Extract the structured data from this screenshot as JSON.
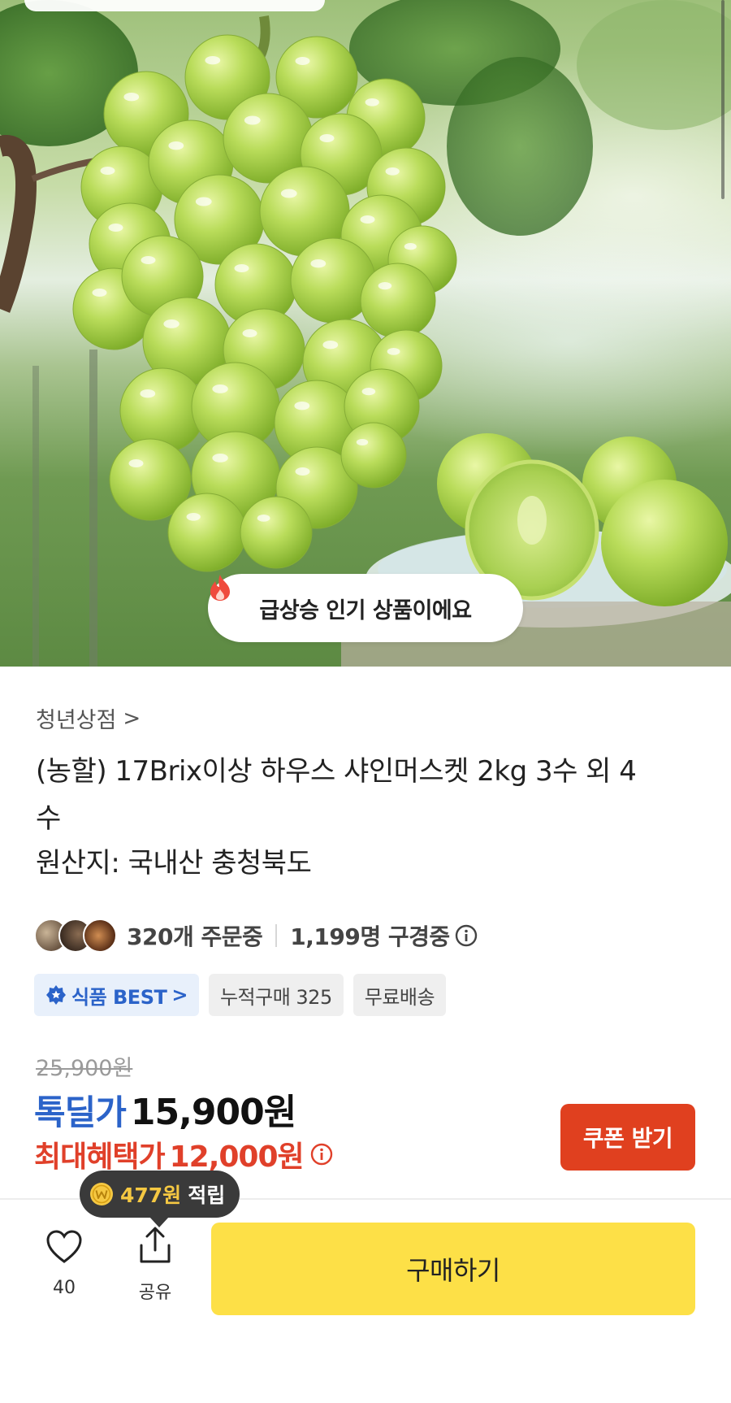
{
  "hero": {
    "trend_badge": "급상승 인기 상품이에요",
    "image_subject": "shine-muscat-grapes-photo"
  },
  "product": {
    "store_name": "청년상점",
    "store_chevron": ">",
    "title": "(농할) 17Brix이상 하우스 샤인머스켓 2kg 3수 외 4수",
    "origin": "원산지: 국내산 충청북도"
  },
  "stats": {
    "orders": "320개 주문중",
    "viewers": "1,199명 구경중"
  },
  "badges": {
    "best": "식품 BEST",
    "best_chevron": ">",
    "cumulative": "누적구매 325",
    "shipping": "무료배송"
  },
  "price": {
    "original": "25,900원",
    "deal_label": "톡딜가",
    "deal_price": "15,900원",
    "max_label": "최대혜택가",
    "max_price": "12,000원"
  },
  "coupon": {
    "label": "쿠폰 받기"
  },
  "points_tooltip": {
    "points": "477원",
    "word": "적립"
  },
  "actions": {
    "like_count": "40",
    "share_label": "공유",
    "buy_label": "구매하기"
  },
  "colors": {
    "deal_blue": "#2b63c9",
    "benefit_red": "#e0402a",
    "coupon_red": "#e0401f",
    "buy_yellow": "#fde047",
    "fire_icon": "#ef4a3c"
  }
}
